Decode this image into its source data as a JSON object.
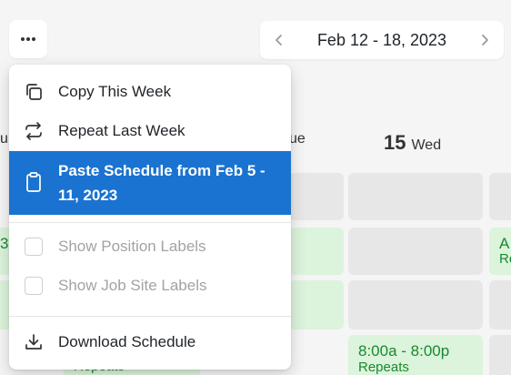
{
  "toolbar": {
    "more_icon": "more-horizontal-icon",
    "date_range": "Feb 12 - 18, 2023",
    "prev_icon": "chevron-left-icon",
    "next_icon": "chevron-right-icon"
  },
  "calendar": {
    "day_partial_left": "u",
    "day_partial_mid": "ue",
    "wednesday": {
      "num": "15",
      "label": "Wed"
    },
    "shift_partial_left": "3",
    "shift_partial_right_time": "A",
    "shift_partial_right_sub": "Re",
    "wed_shift": {
      "time": "8:00a - 8:00p",
      "sub": "Repeats"
    },
    "partial_repeats": "Repeats"
  },
  "menu": {
    "copy_week": "Copy This Week",
    "repeat_last_week": "Repeat Last Week",
    "paste_schedule": "Paste Schedule from Feb 5 - 11, 2023",
    "show_position_labels": "Show Position Labels",
    "show_job_site_labels": "Show Job Site Labels",
    "download_schedule": "Download Schedule"
  },
  "colors": {
    "accent": "#1a73d0",
    "shift_green": "#178a2e",
    "shift_bg": "#dcf3dc"
  }
}
